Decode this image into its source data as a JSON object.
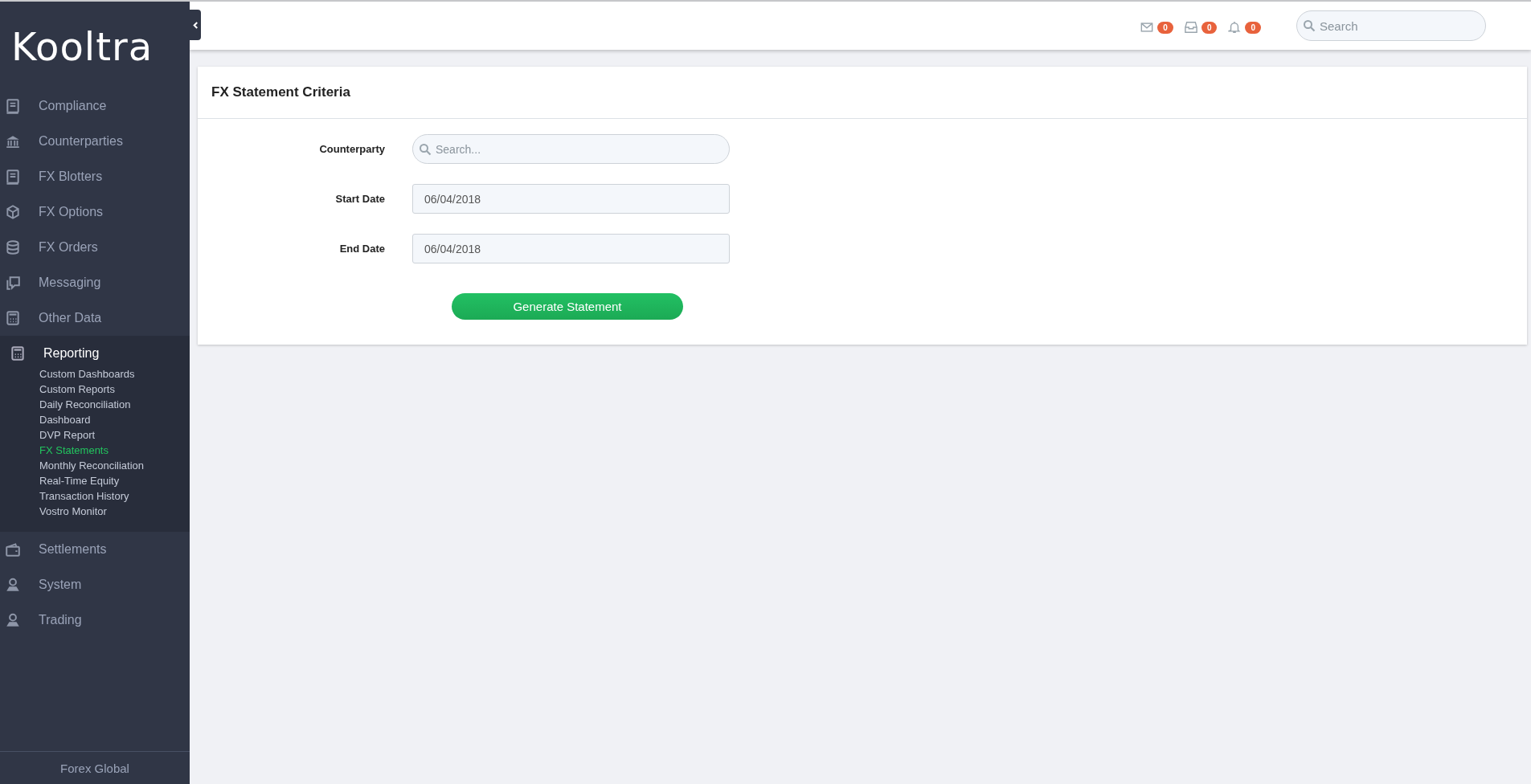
{
  "sidebar": {
    "logo": "Kooltra",
    "items": [
      {
        "label": "Compliance",
        "expanded": false
      },
      {
        "label": "Counterparties",
        "expanded": false
      },
      {
        "label": "FX Blotters",
        "expanded": false
      },
      {
        "label": "FX Options",
        "expanded": false
      },
      {
        "label": "FX Orders",
        "expanded": false
      },
      {
        "label": "Messaging",
        "expanded": false
      },
      {
        "label": "Other Data",
        "expanded": false
      },
      {
        "label": "Reporting",
        "expanded": true,
        "children": [
          {
            "label": "Custom Dashboards",
            "selected": false
          },
          {
            "label": "Custom Reports",
            "selected": false
          },
          {
            "label": "Daily Reconciliation",
            "selected": false
          },
          {
            "label": "Dashboard",
            "selected": false
          },
          {
            "label": "DVP Report",
            "selected": false
          },
          {
            "label": "FX Statements",
            "selected": true
          },
          {
            "label": "Monthly Reconciliation",
            "selected": false
          },
          {
            "label": "Real-Time Equity",
            "selected": false
          },
          {
            "label": "Transaction History",
            "selected": false
          },
          {
            "label": "Vostro Monitor",
            "selected": false
          }
        ]
      },
      {
        "label": "Settlements",
        "expanded": false
      },
      {
        "label": "System",
        "expanded": false
      },
      {
        "label": "Trading",
        "expanded": false
      }
    ],
    "footer": "Forex Global"
  },
  "topbar": {
    "badges": [
      "0",
      "0",
      "0"
    ],
    "search": {
      "placeholder": "Search"
    }
  },
  "card": {
    "title": "FX Statement Criteria",
    "fields": [
      {
        "label": "Counterparty",
        "kind": "search",
        "placeholder": "Search..."
      },
      {
        "label": "Start Date",
        "kind": "date",
        "value": "06/04/2018"
      },
      {
        "label": "End Date",
        "kind": "date",
        "value": "06/04/2018"
      }
    ],
    "button": "Generate Statement"
  }
}
